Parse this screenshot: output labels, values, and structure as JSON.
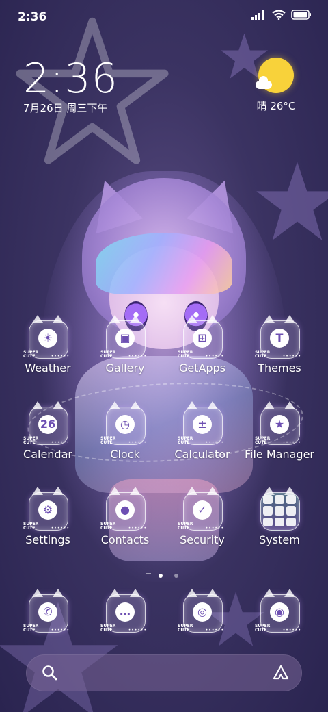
{
  "status_bar": {
    "time": "2:36"
  },
  "widget": {
    "clock": "2:36",
    "date": "7月26日 周三下午",
    "weather": "晴 26°C"
  },
  "apps": [
    {
      "label": "Weather",
      "icon": "weather-icon",
      "glyph": "☀"
    },
    {
      "label": "Gallery",
      "icon": "gallery-icon",
      "glyph": "▣"
    },
    {
      "label": "GetApps",
      "icon": "getapps-icon",
      "glyph": "⊞"
    },
    {
      "label": "Themes",
      "icon": "themes-icon",
      "glyph": "T"
    },
    {
      "label": "Calendar",
      "icon": "calendar-icon",
      "glyph": "26"
    },
    {
      "label": "Clock",
      "icon": "clock-icon",
      "glyph": "◷"
    },
    {
      "label": "Calculator",
      "icon": "calculator-icon",
      "glyph": "±"
    },
    {
      "label": "File Manager",
      "icon": "file-manager-icon",
      "glyph": "★"
    },
    {
      "label": "Settings",
      "icon": "settings-icon",
      "glyph": "⚙"
    },
    {
      "label": "Contacts",
      "icon": "contacts-icon",
      "glyph": "●"
    },
    {
      "label": "Security",
      "icon": "security-icon",
      "glyph": "✓"
    },
    {
      "label": "System",
      "icon": "system-folder-icon",
      "glyph": ""
    }
  ],
  "dock": [
    {
      "icon": "phone-icon",
      "glyph": "✆"
    },
    {
      "icon": "messages-icon",
      "glyph": "…"
    },
    {
      "icon": "browser-icon",
      "glyph": "◎"
    },
    {
      "icon": "camera-icon",
      "glyph": "◉"
    }
  ],
  "icon_tag": "SUPER\nCUTE",
  "icon_dots": "••••••",
  "pager": {
    "pages": 2,
    "active": 1
  },
  "colors": {
    "sun": "#f8d23a",
    "accent": "#6d4fb2"
  }
}
